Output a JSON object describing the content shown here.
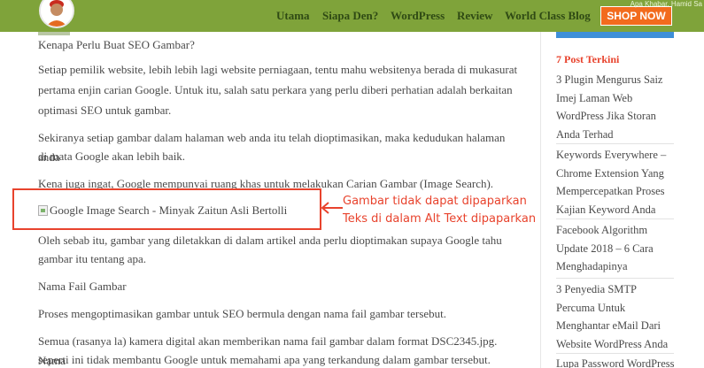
{
  "header": {
    "nav": [
      "Utama",
      "Siapa Den?",
      "WordPress",
      "Review",
      "World Class Blog"
    ],
    "shop_button": "SHOP NOW",
    "tagline": "Apa Khabar, Hamid Sa"
  },
  "article": {
    "paragraphs": [
      "Kenapa Perlu Buat SEO Gambar?",
      "Setiap pemilik website, lebih lebih lagi website perniagaan, tentu mahu websitenya berada di mukasurat",
      "pertama enjin carian Google. Untuk itu, salah satu perkara yang perlu diberi perhatian adalah berkaitan",
      "optimasi SEO untuk gambar.",
      "Sekiranya setiap gambar dalam halaman web anda itu telah dioptimasikan, maka kedudukan halaman anda",
      "di mata Google akan lebih baik.",
      "Kena juga ingat, Google mempunyai ruang khas untuk melakukan Carian Gambar (Image Search).",
      "Oleh sebab itu, gambar yang diletakkan di dalam artikel anda perlu dioptimakan supaya Google tahu",
      "gambar itu tentang apa.",
      "Nama Fail Gambar",
      "Proses mengoptimasikan gambar untuk SEO bermula dengan nama fail gambar tersebut.",
      "Semua (rasanya la) kamera digital akan memberikan nama fail gambar dalam format DSC2345.jpg. Nama",
      "seperti ini tidak membantu Google untuk memahami apa yang terkandung dalam gambar tersebut."
    ],
    "broken_image_alt": "Google Image Search - Minyak Zaitun Asli Bertolli"
  },
  "annotation": {
    "line1": "Gambar tidak dapat dipaparkan",
    "line2": "Teks di dalam Alt Text dipaparkan",
    "color": "#e8432d"
  },
  "sidebar": {
    "heading": "7 Post Terkini",
    "posts": [
      [
        "3 Plugin Mengurus Saiz",
        "Imej Laman Web",
        "WordPress Jika Storan",
        "Anda Terhad"
      ],
      [
        "Keywords Everywhere –",
        "Chrome Extension Yang",
        "Mempercepatkan Proses",
        "Kajian Keyword Anda"
      ],
      [
        "Facebook Algorithm",
        "Update 2018 – 6 Cara",
        "Menghadapinya"
      ],
      [
        "3 Penyedia SMTP",
        "Percuma Untuk",
        "Menghantar eMail Dari",
        "Website WordPress Anda"
      ],
      [
        "Lupa Password WordPress"
      ]
    ]
  },
  "colors": {
    "header_bg": "#7fa33a",
    "shop_button": "#f26b1d",
    "accent_red": "#e8432d",
    "sidebar_bar": "#3e8fd8"
  }
}
